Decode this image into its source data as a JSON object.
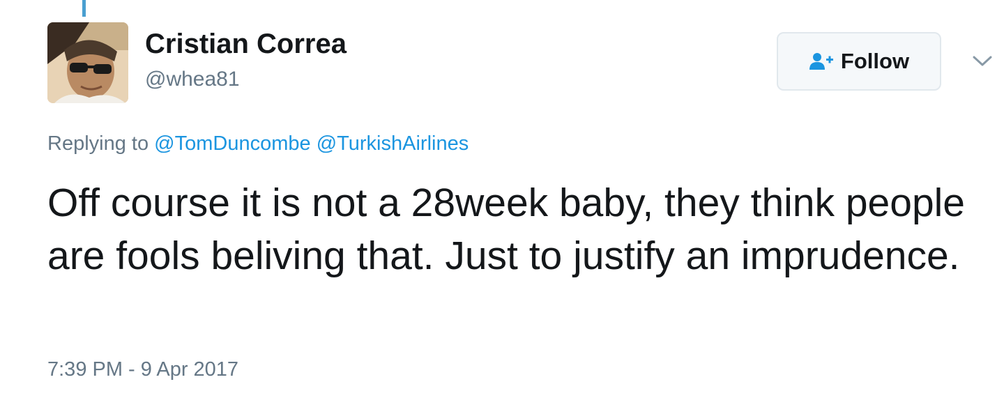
{
  "author": {
    "display_name": "Cristian Correa",
    "handle": "@whea81"
  },
  "actions": {
    "follow_label": "Follow",
    "follow_icon": "add-user-icon",
    "menu_icon": "chevron-down-icon"
  },
  "reply": {
    "prefix": "Replying to",
    "mentions": [
      "@TomDuncombe",
      "@TurkishAirlines"
    ]
  },
  "tweet": {
    "text": "Off course it is not a 28week baby, they think people are fools beliving that. Just to justify an imprudence.",
    "timestamp": "7:39 PM - 9 Apr 2017"
  },
  "colors": {
    "link": "#1b95e0",
    "secondary_text": "#657786",
    "primary_text": "#14171a",
    "thread_line": "#4a9fd0",
    "button_border": "#e1e8ed",
    "button_bg": "#f5f8fa"
  }
}
